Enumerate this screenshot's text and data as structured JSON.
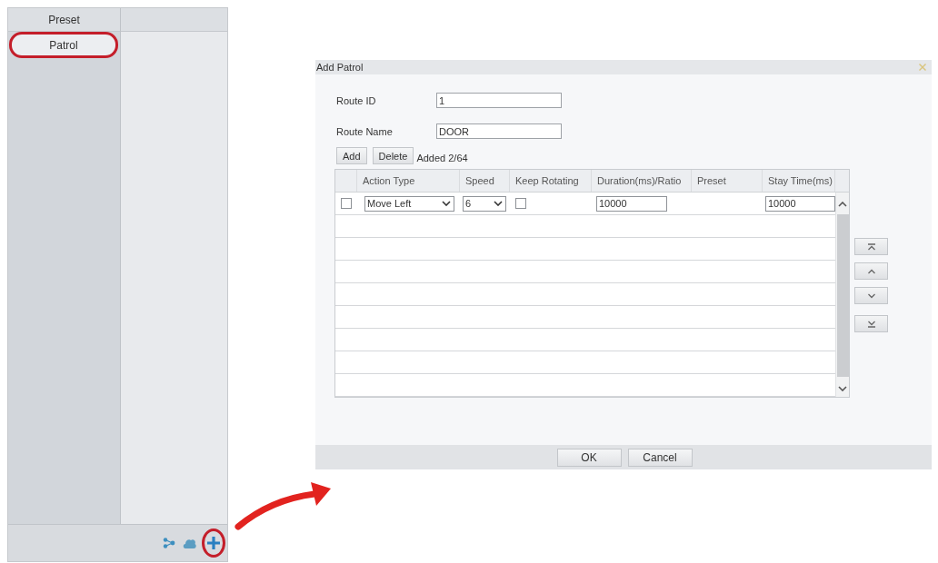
{
  "side_panel": {
    "tabs": [
      {
        "label": "Preset",
        "selected": false,
        "circled": false
      },
      {
        "label": "Patrol",
        "selected": true,
        "circled": true
      }
    ],
    "toolbar_buttons": [
      {
        "kind": "nodes",
        "circled": false
      },
      {
        "kind": "cloud",
        "circled": false
      },
      {
        "kind": "add",
        "circled": true
      }
    ]
  },
  "dialog": {
    "title": "Add Patrol",
    "fields": [
      {
        "label": "Route ID",
        "value": "1"
      },
      {
        "label": "Route Name",
        "value": "DOOR"
      }
    ],
    "buttons": [
      "Add",
      "Delete"
    ],
    "count": "Added 2/64",
    "table": {
      "columns": [
        "Action Type",
        "Speed",
        "Keep Rotating",
        "Duration(ms)/Ratio",
        "Preset",
        "Stay Time(ms)"
      ],
      "rows": [
        {
          "checked": false,
          "action_type": "Move Left",
          "speed": "6",
          "keep_rotating": false,
          "duration": "10000",
          "stay_time": "10000"
        }
      ]
    },
    "footer_buttons": [
      "OK",
      "Cancel"
    ]
  }
}
